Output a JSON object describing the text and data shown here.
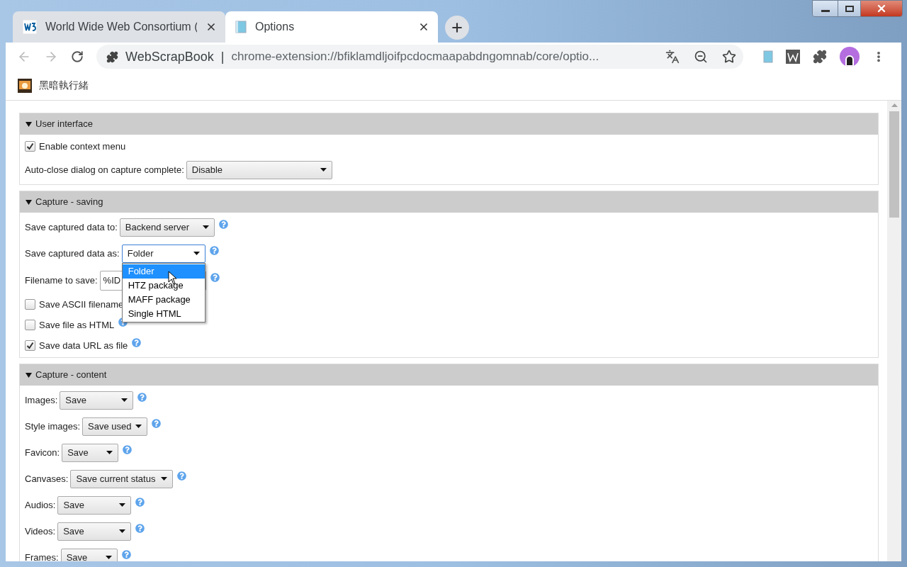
{
  "tabs": [
    {
      "title": "World Wide Web Consortium (",
      "selected": false
    },
    {
      "title": "Options",
      "selected": true
    }
  ],
  "address_bar": {
    "site": "WebScrapBook",
    "separator": "|",
    "url": "chrome-extension://bfiklamdljoifpcdocmaapabdngomnab/core/optio..."
  },
  "bookmarks": [
    {
      "label": "黑暗執行緒"
    }
  ],
  "sections": [
    {
      "title": "User interface",
      "expanded": true,
      "rows": [
        {
          "kind": "checkbox",
          "label": "Enable context menu",
          "checked": true,
          "help": false
        },
        {
          "kind": "select",
          "label": "Auto-close dialog on capture complete:",
          "value": "Disable",
          "help": false
        }
      ]
    },
    {
      "title": "Capture - saving",
      "expanded": true,
      "rows": [
        {
          "kind": "select",
          "label": "Save captured data to:",
          "value": "Backend server",
          "help": true
        },
        {
          "kind": "select",
          "label": "Save captured data as:",
          "value": "Folder",
          "help": true,
          "options": [
            {
              "label": "Folder",
              "selected": true
            },
            {
              "label": "HTZ package",
              "selected": false
            },
            {
              "label": "MAFF package",
              "selected": false
            },
            {
              "label": "Single HTML",
              "selected": false
            }
          ]
        },
        {
          "kind": "text",
          "label": "Filename to save:",
          "value": "%ID",
          "help": true
        },
        {
          "kind": "checkbox",
          "label": "Save ASCII filename",
          "checked": false,
          "help": false
        },
        {
          "kind": "checkbox",
          "label": "Save file as HTML",
          "checked": false,
          "help": true
        },
        {
          "kind": "checkbox",
          "label": "Save data URL as file",
          "checked": true,
          "help": true
        }
      ]
    },
    {
      "title": "Capture - content",
      "expanded": true,
      "rows": [
        {
          "kind": "select",
          "label": "Images:",
          "value": "Save",
          "help": true
        },
        {
          "kind": "select",
          "label": "Style images:",
          "value": "Save used",
          "help": true
        },
        {
          "kind": "select",
          "label": "Favicon:",
          "value": "Save",
          "help": true
        },
        {
          "kind": "select",
          "label": "Canvases:",
          "value": "Save current status",
          "help": true
        },
        {
          "kind": "select",
          "label": "Audios:",
          "value": "Save",
          "help": true
        },
        {
          "kind": "select",
          "label": "Videos:",
          "value": "Save",
          "help": true
        },
        {
          "kind": "select",
          "label": "Frames:",
          "value": "Save",
          "help": true
        }
      ]
    }
  ]
}
